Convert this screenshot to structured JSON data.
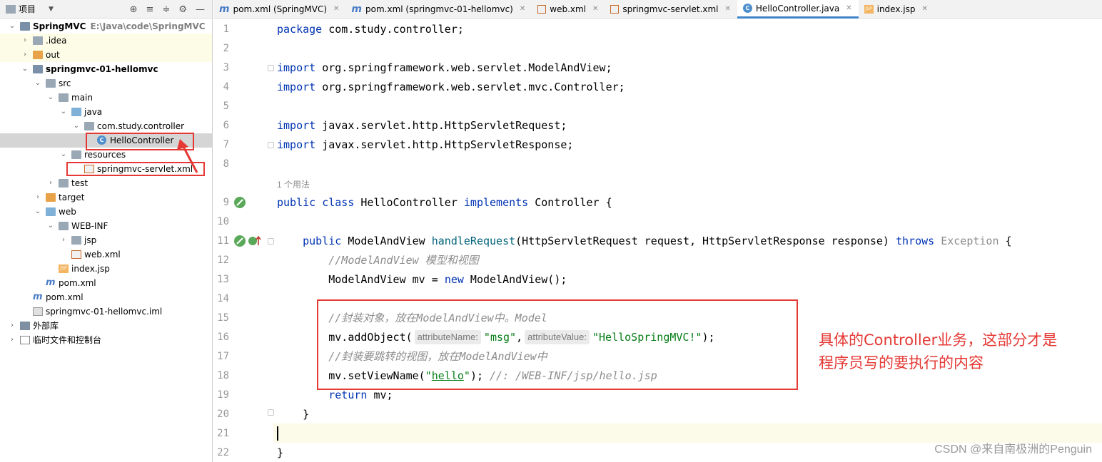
{
  "project_panel": {
    "title": "项目",
    "tools": [
      "⊕",
      "≡",
      "≑",
      "⚙",
      "—"
    ],
    "tree": [
      {
        "label": "SpringMVC",
        "sub": "E:\\Java\\code\\SpringMVC",
        "bold": true,
        "depth": 0,
        "arrow": "open",
        "icon": "module-folder"
      },
      {
        "label": ".idea",
        "depth": 1,
        "arrow": "closed",
        "icon": "folder"
      },
      {
        "label": "out",
        "depth": 1,
        "arrow": "closed",
        "icon": "folder-orange"
      },
      {
        "label": "springmvc-01-hellomvc",
        "bold": true,
        "depth": 1,
        "arrow": "open",
        "icon": "module-folder"
      },
      {
        "label": "src",
        "depth": 2,
        "arrow": "open",
        "icon": "folder"
      },
      {
        "label": "main",
        "depth": 3,
        "arrow": "open",
        "icon": "folder"
      },
      {
        "label": "java",
        "depth": 4,
        "arrow": "open",
        "icon": "folder-blue"
      },
      {
        "label": "com.study.controller",
        "depth": 5,
        "arrow": "open",
        "icon": "package"
      },
      {
        "label": "HelloController",
        "depth": 6,
        "arrow": "none",
        "icon": "class",
        "selected": true
      },
      {
        "label": "resources",
        "depth": 4,
        "arrow": "open",
        "icon": "resources"
      },
      {
        "label": "springmvc-servlet.xml",
        "depth": 5,
        "arrow": "none",
        "icon": "xml"
      },
      {
        "label": "test",
        "depth": 3,
        "arrow": "closed",
        "icon": "folder"
      },
      {
        "label": "target",
        "depth": 2,
        "arrow": "closed",
        "icon": "folder-orange"
      },
      {
        "label": "web",
        "depth": 2,
        "arrow": "open",
        "icon": "web-folder"
      },
      {
        "label": "WEB-INF",
        "depth": 3,
        "arrow": "open",
        "icon": "folder"
      },
      {
        "label": "jsp",
        "depth": 4,
        "arrow": "closed",
        "icon": "folder"
      },
      {
        "label": "web.xml",
        "depth": 4,
        "arrow": "none",
        "icon": "xml"
      },
      {
        "label": "index.jsp",
        "depth": 3,
        "arrow": "none",
        "icon": "jsp"
      },
      {
        "label": "pom.xml",
        "depth": 2,
        "arrow": "none",
        "icon": "maven"
      },
      {
        "label": "pom.xml",
        "depth": 1,
        "arrow": "none",
        "icon": "maven"
      },
      {
        "label": "springmvc-01-hellomvc.iml",
        "depth": 1,
        "arrow": "none",
        "icon": "iml"
      },
      {
        "label": "外部库",
        "depth": 0,
        "arrow": "closed",
        "icon": "library"
      },
      {
        "label": "临时文件和控制台",
        "depth": 0,
        "arrow": "closed",
        "icon": "scratch"
      }
    ]
  },
  "tabs": [
    {
      "label": "pom.xml (SpringMVC)",
      "icon": "maven",
      "active": false
    },
    {
      "label": "pom.xml (springmvc-01-hellomvc)",
      "icon": "maven",
      "active": false
    },
    {
      "label": "web.xml",
      "icon": "xml",
      "active": false
    },
    {
      "label": "springmvc-servlet.xml",
      "icon": "xml",
      "active": false
    },
    {
      "label": "HelloController.java",
      "icon": "class",
      "active": true
    },
    {
      "label": "index.jsp",
      "icon": "jsp",
      "active": false
    }
  ],
  "editor": {
    "line_numbers": [
      "1",
      "2",
      "3",
      "4",
      "5",
      "6",
      "7",
      "8",
      "9",
      "10",
      "11",
      "12",
      "13",
      "14",
      "15",
      "16",
      "17",
      "18",
      "19",
      "20",
      "21",
      "22"
    ],
    "usage_hint": "1 个用法",
    "code": {
      "l1_kw": "package",
      "l1_rest": " com.study.controller;",
      "l3_kw": "import",
      "l3_rest": " org.springframework.web.servlet.ModelAndView;",
      "l4_kw": "import",
      "l4_rest": " org.springframework.web.servlet.mvc.Controller;",
      "l6_kw": "import",
      "l6_rest": " javax.servlet.http.HttpServletRequest;",
      "l7_kw": "import",
      "l7_rest": " javax.servlet.http.HttpServletResponse;",
      "l9_kw1": "public",
      "l9_kw2": "class",
      "l9_name": " HelloController ",
      "l9_kw3": "implements",
      "l9_rest": " Controller {",
      "l11_kw": "public",
      "l11_type": " ModelAndView ",
      "l11_fn": "handleRequest",
      "l11_params": "(HttpServletRequest request, HttpServletResponse response) ",
      "l11_throws": "throws",
      "l11_exc": " Exception",
      "l11_end": " {",
      "l12_cmt": "//ModelAndView 模型和视图",
      "l13_pre": "ModelAndView mv = ",
      "l13_kw": "new",
      "l13_rest": " ModelAndView();",
      "l15_cmt": "//封装对象，放在ModelAndView中。Model",
      "l16_pre": "mv.addObject(",
      "l16_hint1": "attributeName:",
      "l16_str1": "\"msg\"",
      "l16_comma": ",",
      "l16_hint2": "attributeValue:",
      "l16_str2": "\"HelloSpringMVC!\"",
      "l16_end": ");",
      "l17_cmt": "//封装要跳转的视图，放在ModelAndView中",
      "l18_pre": "mv.setViewName(",
      "l18_q1": "\"",
      "l18_str": "hello",
      "l18_q2": "\"",
      "l18_mid": "); ",
      "l18_cmt": "//: /WEB-INF/jsp/hello.jsp",
      "l19_kw": "return",
      "l19_rest": " mv;",
      "l20": "}",
      "l22": "}"
    },
    "annotation": [
      "具体的Controller业务，这部分才是",
      "程序员写的要执行的内容"
    ],
    "watermark": "CSDN @来自南极洲的Penguin"
  },
  "colors": {
    "keyword": "#0033b3",
    "string": "#067d17",
    "comment": "#8c8c8c",
    "method": "#00627a",
    "annotation_red": "#e53935",
    "tab_active_underline": "#4083c9"
  }
}
